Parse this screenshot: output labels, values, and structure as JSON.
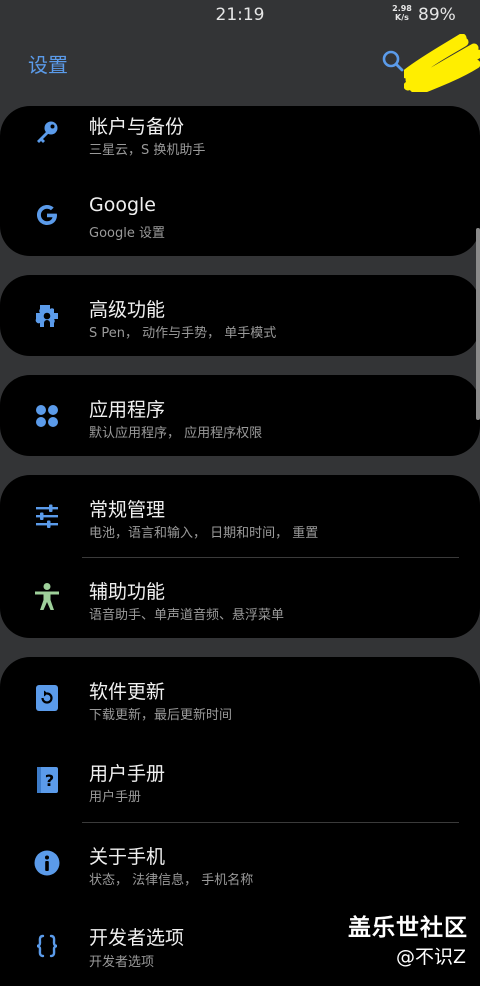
{
  "status_bar": {
    "time": "21:19",
    "net_speed_value": "2.98",
    "net_speed_unit": "K/s",
    "battery": "89%"
  },
  "header": {
    "title": "设置",
    "search_icon": "search-icon"
  },
  "groups": [
    {
      "items": [
        {
          "title": "帐户与备份",
          "subtitle": "三星云，S 换机助手",
          "icon": "key-icon"
        },
        {
          "title": "Google",
          "subtitle": "Google 设置",
          "icon": "google-icon"
        }
      ]
    },
    {
      "items": [
        {
          "title": "高级功能",
          "subtitle": "S Pen， 动作与手势， 单手模式",
          "icon": "puzzle-gear-icon"
        }
      ]
    },
    {
      "items": [
        {
          "title": "应用程序",
          "subtitle": "默认应用程序， 应用程序权限",
          "icon": "apps-grid-icon"
        }
      ]
    },
    {
      "items": [
        {
          "title": "常规管理",
          "subtitle": "电池，语言和输入， 日期和时间， 重置",
          "icon": "sliders-icon"
        },
        {
          "title": "辅助功能",
          "subtitle": "语音助手、单声道音频、悬浮菜单",
          "icon": "accessibility-icon"
        }
      ]
    },
    {
      "items": [
        {
          "title": "软件更新",
          "subtitle": "下载更新，最后更新时间",
          "icon": "update-icon"
        },
        {
          "title": "用户手册",
          "subtitle": "用户手册",
          "icon": "manual-icon"
        },
        {
          "title": "关于手机",
          "subtitle": "状态， 法律信息， 手机名称",
          "icon": "info-icon"
        },
        {
          "title": "开发者选项",
          "subtitle": "开发者选项",
          "icon": "developer-braces-icon"
        }
      ]
    }
  ],
  "watermark": {
    "line1": "盖乐世社区",
    "line2": "@不识Z"
  },
  "colors": {
    "accent": "#5b9bea",
    "accessibility_green": "#9ed09a",
    "card_bg": "#000000",
    "page_bg": "#333436",
    "highlight_scribble": "#ffee00"
  }
}
